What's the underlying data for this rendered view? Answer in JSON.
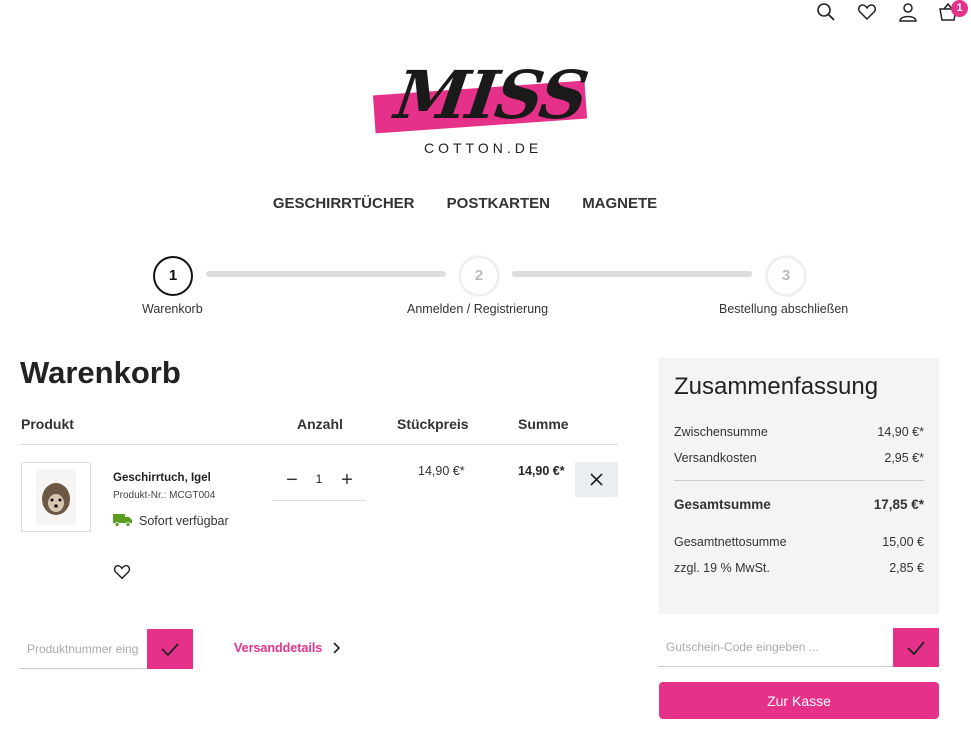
{
  "header": {
    "cart_count": "1"
  },
  "logo": {
    "word": "MISS",
    "sub": "COTTON.DE"
  },
  "nav": {
    "items": [
      "GESCHIRRTÜCHER",
      "POSTKARTEN",
      "MAGNETE"
    ]
  },
  "steps": [
    {
      "number": "1",
      "label": "Warenkorb"
    },
    {
      "number": "2",
      "label": "Anmelden / Registrierung"
    },
    {
      "number": "3",
      "label": "Bestellung abschließen"
    }
  ],
  "cart": {
    "title": "Warenkorb",
    "headers": {
      "product": "Produkt",
      "qty": "Anzahl",
      "unit_price": "Stückpreis",
      "sum": "Summe"
    },
    "item": {
      "name": "Geschirrtuch, Igel",
      "nr": "Produkt-Nr.: MCGT004",
      "availability": "Sofort verfügbar",
      "qty": "1",
      "unit_price": "14,90 €*",
      "sum": "14,90 €*"
    },
    "product_number_placeholder": "Produktnummer eingeben ...",
    "shipping_link": "Versanddetails"
  },
  "summary": {
    "title": "Zusammenfassung",
    "subtotal_label": "Zwischensumme",
    "subtotal": "14,90 €*",
    "shipping_label": "Versandkosten",
    "shipping": "2,95 €*",
    "total_label": "Gesamtsumme",
    "total": "17,85 €*",
    "net_label": "Gesamtnettosumme",
    "net": "15,00 €",
    "vat_label": "zzgl. 19 % MwSt.",
    "vat": "2,85 €",
    "voucher_placeholder": "Gutschein-Code eingeben ...",
    "checkout_label": "Zur Kasse"
  },
  "colors": {
    "accent": "#e6318a",
    "available": "#5a9e1f"
  }
}
